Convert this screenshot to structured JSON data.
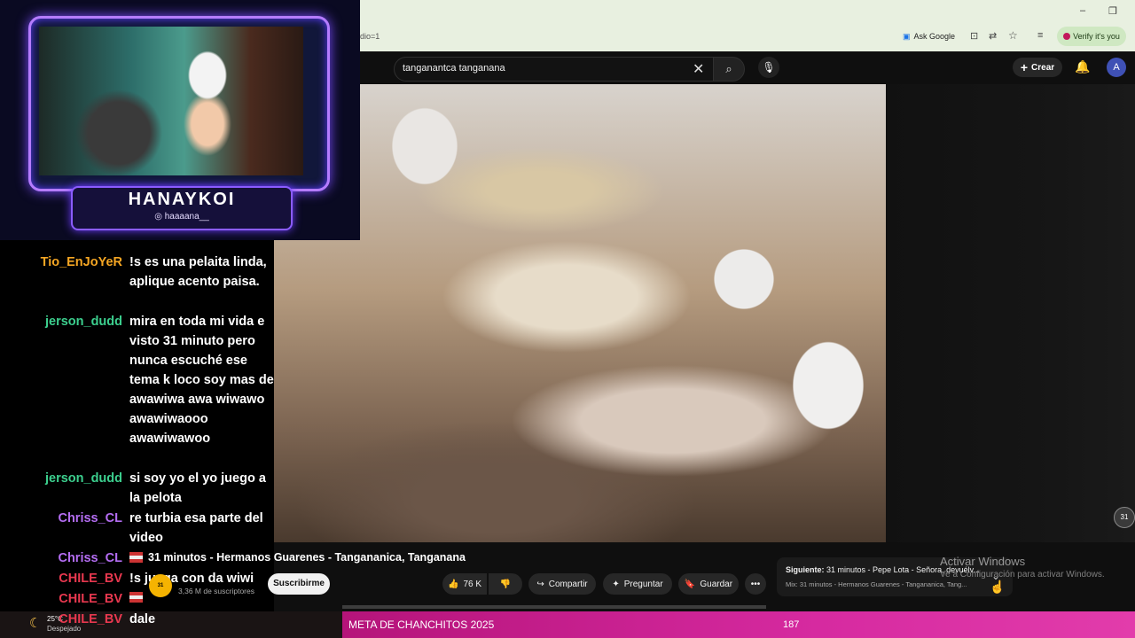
{
  "browser": {
    "url_fragment": "dio=1",
    "ask_google": "Ask Google",
    "verify": "Verify it's you",
    "minimize": "–",
    "restore": "❐"
  },
  "youtube": {
    "search_query": "tanganantca tanganana",
    "create_label": "Crear",
    "avatar_letter": "A",
    "video_title": "31 minutos - Hermanos Guarenes - Tangananica, Tanganana",
    "channel_badge": "31 MINUTOS",
    "subscribers": "3,36 M de suscriptores",
    "subscribe_label": "Suscribirme",
    "likes": "76 K",
    "share_label": "Compartir",
    "ask_label": "Preguntar",
    "save_label": "Guardar",
    "more_label": "•••",
    "next_prefix": "Siguiente:",
    "next_title": "31 minutos - Pepe Lota - Señora, devuélv...",
    "next_mix": "Mix: 31 minutos - Hermanos Guarenes - Tangananica, Tang..."
  },
  "overlay": {
    "streamer_name": "HANAYKOI",
    "instagram": "haaaana__"
  },
  "chat": [
    {
      "user": "Tio_EnJoYeR",
      "color": "#f5a623",
      "text": "!s es una pelaita linda, aplique acento paisa."
    },
    {
      "user": "jerson_dudd",
      "color": "#3ccf8e",
      "text": "mira en toda mi vida e visto 31 minuto pero nunca escuché ese tema k loco soy mas de awawiwa awa wiwawo awawiwaooo awawiwawoo"
    },
    {
      "user": "jerson_dudd",
      "color": "#3ccf8e",
      "text": "si soy yo el yo juego a la pelota"
    },
    {
      "user": "Chriss_CL",
      "color": "#b46df2",
      "text": "re turbia esa parte del video"
    },
    {
      "user": "Chriss_CL",
      "color": "#b46df2",
      "text": ""
    },
    {
      "user": "CHILE_BV",
      "color": "#e8384f",
      "text": "!s juega con da wiwi"
    },
    {
      "user": "CHILE_BV",
      "color": "#e8384f",
      "text": ""
    },
    {
      "user": "CHILE_BV",
      "color": "#e8384f",
      "text": "dale"
    }
  ],
  "windows": {
    "activate_title": "Activar Windows",
    "activate_sub": "Ve a Configuración para activar Windows.",
    "temp": "25°C",
    "condition": "Despejado"
  },
  "goal": {
    "label": "META DE CHANCHITOS 2025",
    "count": "187"
  },
  "icons": {
    "search": "search-icon",
    "mic": "mic-icon",
    "bell": "bell-icon",
    "like": "thumbs-up-icon",
    "dislike": "thumbs-down-icon"
  }
}
